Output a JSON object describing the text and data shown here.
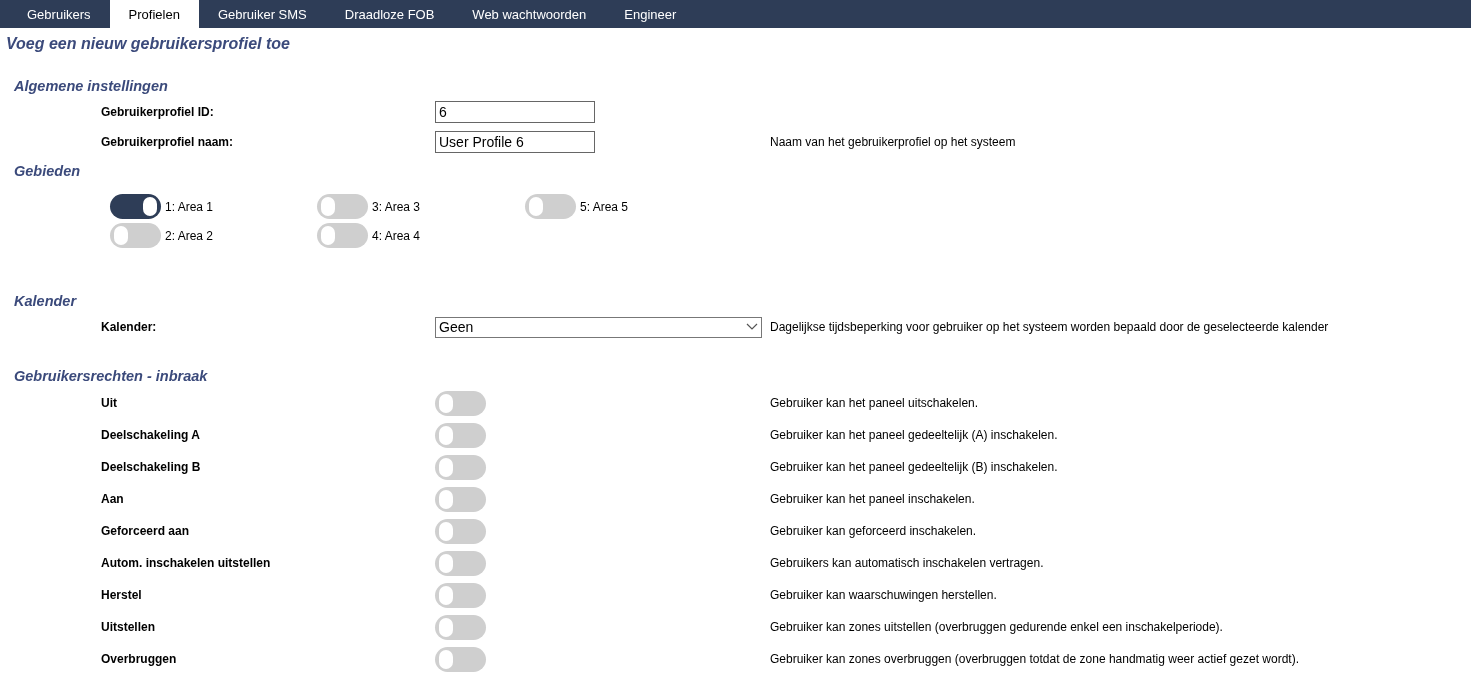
{
  "tabs": [
    {
      "label": "Gebruikers",
      "selected": false
    },
    {
      "label": "Profielen",
      "selected": true
    },
    {
      "label": "Gebruiker SMS",
      "selected": false
    },
    {
      "label": "Draadloze FOB",
      "selected": false
    },
    {
      "label": "Web wachtwoorden",
      "selected": false
    },
    {
      "label": "Engineer",
      "selected": false
    }
  ],
  "page_title": "Voeg een nieuw gebruikersprofiel toe",
  "general": {
    "heading": "Algemene instellingen",
    "fields": [
      {
        "label": "Gebruikerprofiel ID:",
        "value": "6"
      },
      {
        "label": "Gebruikerprofiel naam:",
        "value": "User Profile 6",
        "description": "Naam van het gebruikerprofiel op het systeem"
      }
    ]
  },
  "areas": {
    "heading": "Gebieden",
    "items": [
      {
        "label": "1: Area 1",
        "on": true
      },
      {
        "label": "2: Area 2",
        "on": false
      },
      {
        "label": "3: Area 3",
        "on": false
      },
      {
        "label": "4: Area 4",
        "on": false
      },
      {
        "label": "5: Area 5",
        "on": false
      }
    ]
  },
  "calendar": {
    "heading": "Kalender",
    "label": "Kalender:",
    "value": "Geen",
    "description": "Dagelijkse tijdsbeperking voor gebruiker op het systeem worden bepaald door de geselecteerde kalender"
  },
  "rights": {
    "heading": "Gebruikersrechten - inbraak",
    "items": [
      {
        "label": "Uit",
        "on": false,
        "description": "Gebruiker kan het paneel uitschakelen."
      },
      {
        "label": "Deelschakeling A",
        "on": false,
        "description": "Gebruiker kan het paneel gedeeltelijk (A) inschakelen."
      },
      {
        "label": "Deelschakeling B",
        "on": false,
        "description": "Gebruiker kan het paneel gedeeltelijk (B) inschakelen."
      },
      {
        "label": "Aan",
        "on": false,
        "description": "Gebruiker kan het paneel inschakelen."
      },
      {
        "label": "Geforceerd aan",
        "on": false,
        "description": "Gebruiker kan geforceerd inschakelen."
      },
      {
        "label": "Autom. inschakelen uitstellen",
        "on": false,
        "description": "Gebruikers kan automatisch inschakelen vertragen."
      },
      {
        "label": "Herstel",
        "on": false,
        "description": "Gebruiker kan waarschuwingen herstellen."
      },
      {
        "label": "Uitstellen",
        "on": false,
        "description": "Gebruiker kan zones uitstellen (overbruggen gedurende enkel een inschakelperiode)."
      },
      {
        "label": "Overbruggen",
        "on": false,
        "description": "Gebruiker kan zones overbruggen (overbruggen totdat de zone handmatig weer actief gezet wordt)."
      }
    ]
  }
}
